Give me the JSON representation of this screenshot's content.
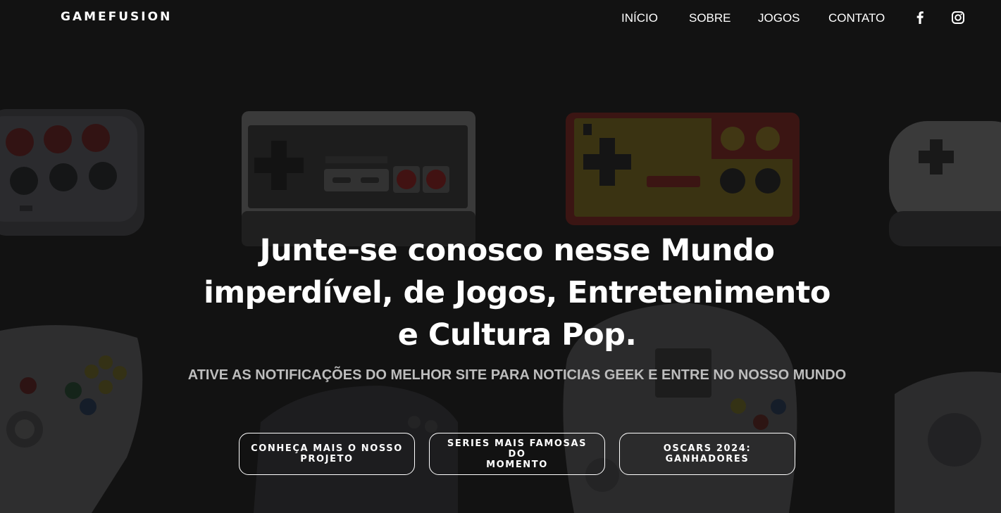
{
  "brand": {
    "name": "GAMEFUSION"
  },
  "nav": {
    "items": [
      "INÍCIO",
      "SOBRE",
      "JOGOS",
      "CONTATO"
    ],
    "social": [
      "facebook-icon",
      "instagram-icon"
    ]
  },
  "hero": {
    "headline_lines": [
      "Junte-se conosco nesse Mundo",
      "imperdível, de Jogos, Entretenimento",
      "e Cultura Pop."
    ],
    "subtitle": "ATIVE AS NOTIFICAÇÕES DO MELHOR SITE PARA NOTICIAS GEEK E ENTRE NO NOSSO MUNDO",
    "background": "retro-game-controllers-image",
    "buttons": [
      {
        "label_lines": [
          "CONHEÇA MAIS O NOSSO",
          "PROJETO"
        ]
      },
      {
        "label_lines": [
          "SERIES MAIS FAMOSAS DO",
          "MOMENTO"
        ]
      },
      {
        "label_lines": [
          "OSCARS 2024: GANHADORES"
        ]
      }
    ]
  },
  "colors": {
    "overlay": "#121212",
    "text": "#ffffff",
    "subtitle": "#bdbdbd",
    "nes_red": "#7a1212",
    "famicom_red": "#6e1a14",
    "famicom_yellow": "#6b5c12"
  }
}
